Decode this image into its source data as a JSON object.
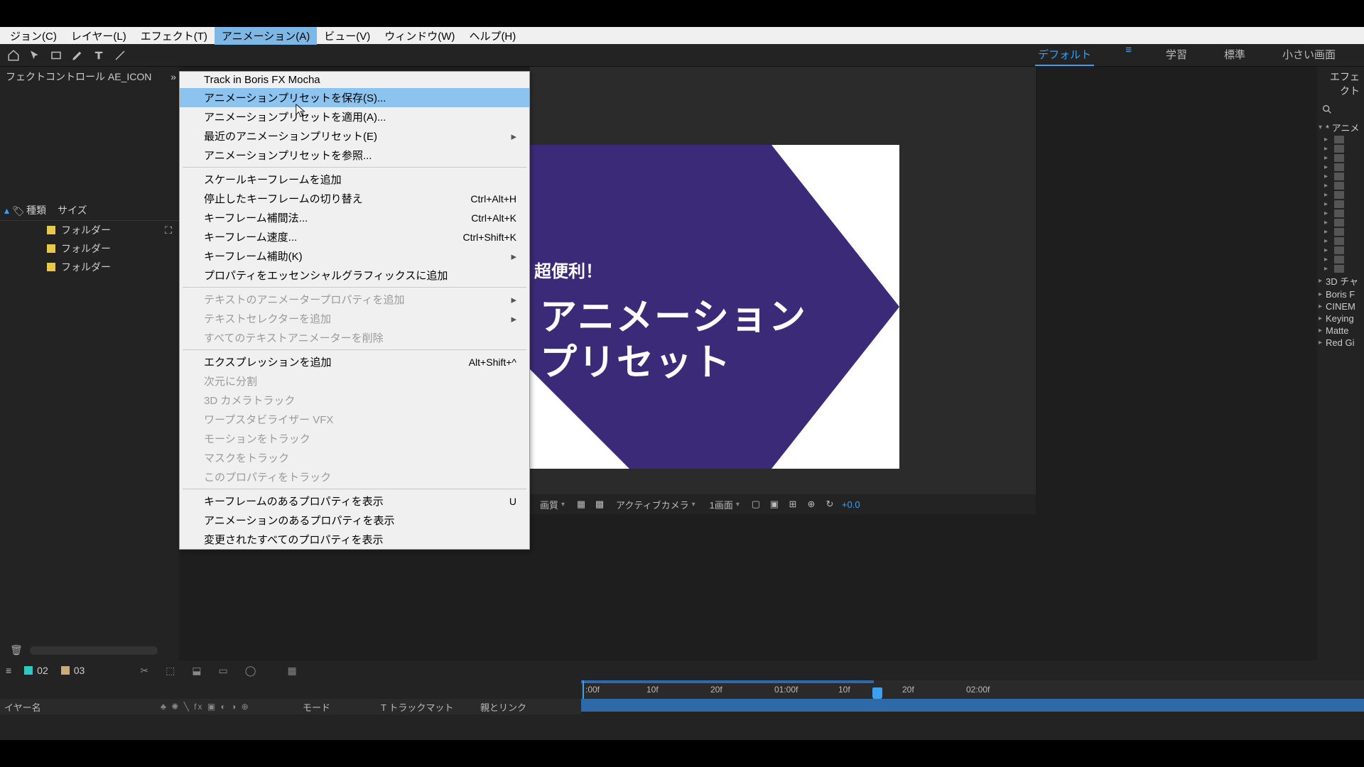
{
  "menubar": {
    "items": [
      "ジョン(C)",
      "レイヤー(L)",
      "エフェクト(T)",
      "アニメーション(A)",
      "ビュー(V)",
      "ウィンドウ(W)",
      "ヘルプ(H)"
    ],
    "open_index": 3
  },
  "workspaces": {
    "items": [
      "デフォルト",
      "学習",
      "標準",
      "小さい画面"
    ],
    "active_index": 0
  },
  "left_panel": {
    "tab": "フェクトコントロール AE_ICON",
    "columns": {
      "kind": "種類",
      "size": "サイズ"
    },
    "items": [
      "フォルダー",
      "フォルダー",
      "フォルダー"
    ]
  },
  "dropdown": {
    "groups": [
      [
        {
          "label": "Track in Boris FX Mocha",
          "shortcut": "",
          "sub": false,
          "disabled": false,
          "hl": false
        },
        {
          "label": "アニメーションプリセットを保存(S)...",
          "shortcut": "",
          "sub": false,
          "disabled": false,
          "hl": true
        },
        {
          "label": "アニメーションプリセットを適用(A)...",
          "shortcut": "",
          "sub": false,
          "disabled": false,
          "hl": false
        },
        {
          "label": "最近のアニメーションプリセット(E)",
          "shortcut": "",
          "sub": true,
          "disabled": false,
          "hl": false
        },
        {
          "label": "アニメーションプリセットを参照...",
          "shortcut": "",
          "sub": false,
          "disabled": false,
          "hl": false
        }
      ],
      [
        {
          "label": "スケールキーフレームを追加",
          "shortcut": "",
          "sub": false,
          "disabled": false,
          "hl": false
        },
        {
          "label": "停止したキーフレームの切り替え",
          "shortcut": "Ctrl+Alt+H",
          "sub": false,
          "disabled": false,
          "hl": false
        },
        {
          "label": "キーフレーム補間法...",
          "shortcut": "Ctrl+Alt+K",
          "sub": false,
          "disabled": false,
          "hl": false
        },
        {
          "label": "キーフレーム速度...",
          "shortcut": "Ctrl+Shift+K",
          "sub": false,
          "disabled": false,
          "hl": false
        },
        {
          "label": "キーフレーム補助(K)",
          "shortcut": "",
          "sub": true,
          "disabled": false,
          "hl": false
        },
        {
          "label": "プロパティをエッセンシャルグラフィックスに追加",
          "shortcut": "",
          "sub": false,
          "disabled": false,
          "hl": false
        }
      ],
      [
        {
          "label": "テキストのアニメータープロパティを追加",
          "shortcut": "",
          "sub": true,
          "disabled": true,
          "hl": false
        },
        {
          "label": "テキストセレクターを追加",
          "shortcut": "",
          "sub": true,
          "disabled": true,
          "hl": false
        },
        {
          "label": "すべてのテキストアニメーターを削除",
          "shortcut": "",
          "sub": false,
          "disabled": true,
          "hl": false
        }
      ],
      [
        {
          "label": "エクスプレッションを追加",
          "shortcut": "Alt+Shift+^",
          "sub": false,
          "disabled": false,
          "hl": false
        },
        {
          "label": "次元に分割",
          "shortcut": "",
          "sub": false,
          "disabled": true,
          "hl": false
        },
        {
          "label": "3D カメラトラック",
          "shortcut": "",
          "sub": false,
          "disabled": true,
          "hl": false
        },
        {
          "label": "ワープスタビライザー VFX",
          "shortcut": "",
          "sub": false,
          "disabled": true,
          "hl": false
        },
        {
          "label": "モーションをトラック",
          "shortcut": "",
          "sub": false,
          "disabled": true,
          "hl": false
        },
        {
          "label": "マスクをトラック",
          "shortcut": "",
          "sub": false,
          "disabled": true,
          "hl": false
        },
        {
          "label": "このプロパティをトラック",
          "shortcut": "",
          "sub": false,
          "disabled": true,
          "hl": false
        }
      ],
      [
        {
          "label": "キーフレームのあるプロパティを表示",
          "shortcut": "U",
          "sub": false,
          "disabled": false,
          "hl": false
        },
        {
          "label": "アニメーションのあるプロパティを表示",
          "shortcut": "",
          "sub": false,
          "disabled": false,
          "hl": false
        },
        {
          "label": "変更されたすべてのプロパティを表示",
          "shortcut": "",
          "sub": false,
          "disabled": false,
          "hl": false
        }
      ]
    ]
  },
  "canvas": {
    "small": "超便利！",
    "line1": "アニメーション",
    "line2": "プリセット"
  },
  "viewer_footer": {
    "quality": "画質",
    "camera": "アクティブカメラ",
    "view": "1画面",
    "exposure": "+0.0"
  },
  "right_panel": {
    "header": "エフェクト",
    "root": "* アニメ",
    "leaves": [
      "3D チャ",
      "Boris F",
      "CINEM",
      "Keying",
      "Matte",
      "Red Gi"
    ]
  },
  "timeline": {
    "tabs": [
      "02",
      "03"
    ],
    "ruler": [
      ":00f",
      "10f",
      "20f",
      "01:00f",
      "10f",
      "20f",
      "02:00f"
    ],
    "col_layer": "イヤー名",
    "col_switches": "♣ ✺ ╲ fx ▣ ◐ ◑ ⊕",
    "col_mode": "モード",
    "col_trackmatte": "T  トラックマット",
    "col_parent": "親とリンク"
  }
}
